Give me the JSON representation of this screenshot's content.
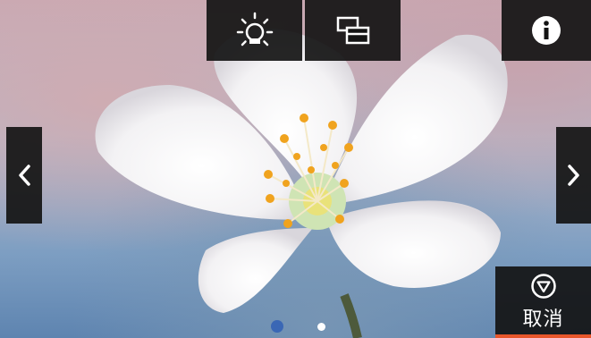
{
  "photo": {
    "subject": "white-flower-photo"
  },
  "toolbar": {
    "buttons": [
      {
        "name": "brightness-button",
        "icon": "brightness-icon"
      },
      {
        "name": "layout-button",
        "icon": "layout-icon"
      },
      {
        "name": "info-button",
        "icon": "info-icon"
      }
    ]
  },
  "nav": {
    "prev_icon": "chevron-left-icon",
    "next_icon": "chevron-right-icon"
  },
  "cancel": {
    "label": "取消",
    "icon": "stop-icon"
  },
  "pager": {
    "count": 2,
    "active_index": 0
  },
  "colors": {
    "accent": "#e8562a",
    "active_dot": "#3a67b5",
    "inactive_dot": "#ffffff"
  }
}
